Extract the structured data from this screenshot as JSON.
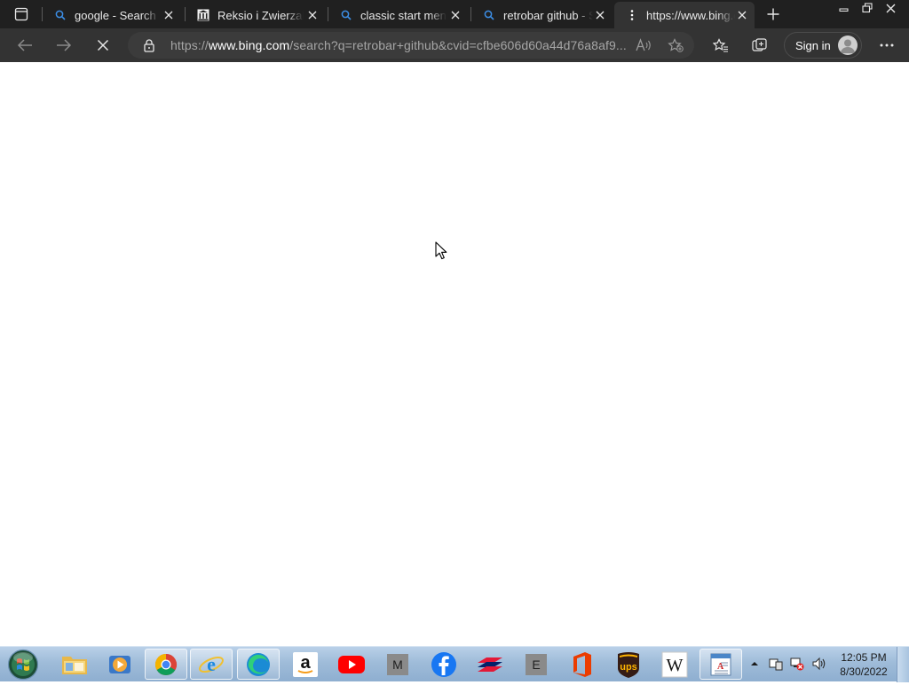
{
  "browser": {
    "tabs": [
      {
        "title": "google - Search",
        "favicon": "search-icon",
        "active": false
      },
      {
        "title": "Reksio i Zwierzaki",
        "favicon": "wiki-icon",
        "active": false
      },
      {
        "title": "classic start menu",
        "favicon": "search-icon",
        "active": false
      },
      {
        "title": "retrobar github - Search",
        "favicon": "search-icon",
        "active": false
      },
      {
        "title": "https://www.bing.com",
        "favicon": "loading-icon",
        "active": true
      }
    ],
    "address": {
      "scheme": "https://",
      "host": "www.bing.com",
      "path": "/search?q=retrobar+github&cvid=cfbe606d60a44d76a8af9..."
    },
    "signin_label": "Sign in",
    "colors": {
      "tabstrip": "#202020",
      "toolbar": "#333333",
      "content": "#ffffff"
    }
  },
  "taskbar": {
    "pinned": [
      {
        "name": "file-explorer",
        "label": "Windows Explorer"
      },
      {
        "name": "media-player",
        "label": "Windows Media Player"
      },
      {
        "name": "chrome",
        "label": "Google Chrome"
      },
      {
        "name": "internet-explorer",
        "label": "Internet Explorer"
      },
      {
        "name": "edge",
        "label": "Microsoft Edge"
      },
      {
        "name": "amazon",
        "label": "a"
      },
      {
        "name": "youtube",
        "label": "YouTube"
      },
      {
        "name": "m-app",
        "label": "M"
      },
      {
        "name": "facebook",
        "label": "f"
      },
      {
        "name": "bank-of-america",
        "label": "Bank of America"
      },
      {
        "name": "e-app",
        "label": "E"
      },
      {
        "name": "office",
        "label": "Office"
      },
      {
        "name": "ups",
        "label": "ups"
      },
      {
        "name": "wikipedia",
        "label": "W"
      },
      {
        "name": "document",
        "label": "Document"
      }
    ],
    "clock": {
      "time": "12:05 PM",
      "date": "8/30/2022"
    }
  }
}
